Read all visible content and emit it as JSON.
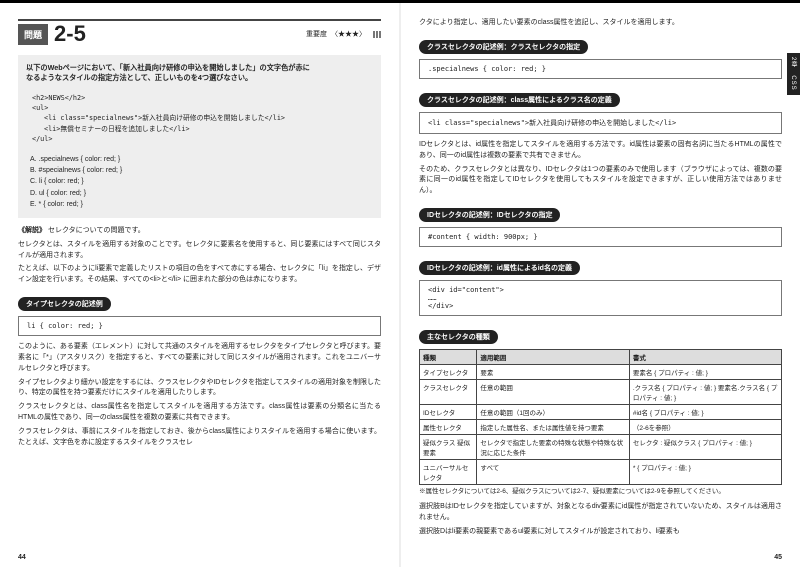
{
  "left": {
    "qlabel": "問題",
    "qnum": "2-5",
    "imp_label": "重要度",
    "stars": "〈★★★〉",
    "question_line1": "以下のWebページにおいて、「新入社員向け研修の申込を開始しました」の文字色が赤に",
    "question_line2": "なるようなスタイルの指定方法として、正しいものを4つ選びなさい。",
    "html1": "<h2>NEWS</h2>",
    "html2": "<ul>",
    "html3": "<li class=\"specialnews\">新入社員向け研修の申込を開始しました</li>",
    "html4": "<li>無償セミナーの日程を追加しました</li>",
    "html5": "</ul>",
    "cA": "A. .specialnews { color: red; }",
    "cB": "B. #specialnews { color: red; }",
    "cC": "C. li { color: red; }",
    "cD": "D. ul { color: red; }",
    "cE": "E. * { color: red; }",
    "exp_label": "《解説》",
    "exp_p1": "セレクタについての問題です。",
    "exp_p2": "セレクタとは、スタイルを適用する対象のことです。セレクタに要素名を使用すると、同じ要素にはすべて同じスタイルが適用されます。",
    "exp_p3": "たとえば、以下のようにli要素で定義したリストの項目の色をすべて赤にする場合、セレクタに「li」を指定し、デザイン設定を行います。その結果、すべての<li>と</li> に囲まれた部分の色は赤になります。",
    "bar1": "タイプセレクタの記述例",
    "code1": "li { color: red; }",
    "p4": "このように、ある要素（エレメント）に対して共通のスタイルを適用するセレクタをタイプセレクタと呼びます。要素名に「*」（アスタリスク）を指定すると、すべての要素に対して同じスタイルが適用されます。これをユニバーサルセレクタと呼びます。",
    "p5": "タイプセレクタより細かい設定をするには、クラスセレクタやIDセレクタを指定してスタイルの適用対象を制限したり、特定の属性を持つ要素だけにスタイルを適用したりします。",
    "p6": "クラスセレクタとは、class属性名を指定してスタイルを適用する方法です。class属性は要素の分類名に当たるHTMLの属性であり、同一のclass属性を複数の要素に共有できます。",
    "p7": "クラスセレクタは、事前にスタイルを指定しておき、後からclass属性によりスタイルを適用する場合に使います。たとえば、文字色を赤に設定するスタイルをクラスセレ",
    "pagenum": "44"
  },
  "right": {
    "top": "クタにより指定し、適用したい要素のclass属性を追記し、スタイルを適用します。",
    "bar2": "クラスセレクタの記述例：クラスセレクタの指定",
    "code2": ".specialnews { color: red; }",
    "bar3": "クラスセレクタの記述例：class属性によるクラス名の定義",
    "code3": "<li class=\"specialnews\">新入社員向け研修の申込を開始しました</li>",
    "p8": "IDセレクタとは、id属性を指定してスタイルを適用する方法です。id属性は要素の固有名詞に当たるHTMLの属性であり、同一のid属性は複数の要素で共有できません。",
    "p9": "そのため、クラスセレクタとは異なり、IDセレクタは1つの要素のみで使用します（ブラウザによっては、複数の要素に同一のid属性を指定してIDセレクタを使用してもスタイルを設定できますが、正しい使用方法ではありません）。",
    "bar4": "IDセレクタの記述例：IDセレクタの指定",
    "code4": "#content { width: 900px; }",
    "bar5": "IDセレクタの記述例：id属性によるid名の定義",
    "code5a": "<div id=\"content\">",
    "code5b": "……",
    "code5c": "</div>",
    "bar6": "主なセレクタの種類",
    "th1": "種類",
    "th2": "適用範囲",
    "th3": "書式",
    "r1c1": "タイプセレクタ",
    "r1c2": "要素",
    "r1c3": "要素名 { プロパティ : 値; }",
    "r2c1": "クラスセレクタ",
    "r2c2": "任意の範囲",
    "r2c3": ".クラス名 { プロパティ : 値; }\n要素名.クラス名 { プロパティ : 値; }",
    "r3c1": "IDセレクタ",
    "r3c2": "任意の範囲（1回のみ）",
    "r3c3": "#id名 { プロパティ : 値; }",
    "r4c1": "属性セレクタ",
    "r4c2": "指定した属性名、または属性値を持つ要素",
    "r4c3": "（2-6を参照）",
    "r5c1": "疑似クラス\n疑似要素",
    "r5c2": "セレクタで指定した要素の特殊な状態や特殊な状況に応じた条件",
    "r5c3": "セレクタ : 疑似クラス { プロパティ : 値; }",
    "r6c1": "ユニバーサルセレクタ",
    "r6c2": "すべて",
    "r6c3": "* { プロパティ : 値; }",
    "note1": "※属性セレクタについては2-6、疑似クラスについては2-7、疑似要素については2-9を参照してください。",
    "p10": "選択肢BはIDセレクタを指定していますが、対象となるdiv要素にid属性が指定されていないため、スタイルは適用されません。",
    "p11": "選択肢Dはli要素の親要素であるul要素に対してスタイルが設定されており、li要素も",
    "pagenum": "45",
    "tab": "2章　CSS"
  }
}
